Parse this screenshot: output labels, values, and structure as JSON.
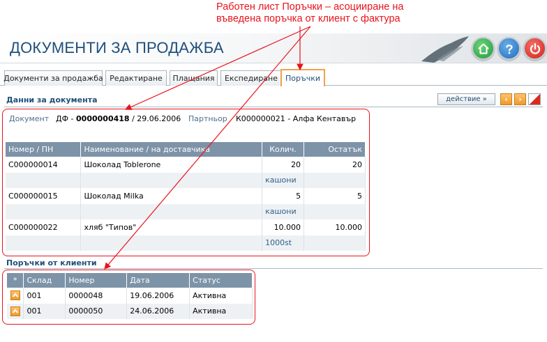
{
  "annotation": {
    "line1": "Работен лист Поръчки – асоцииране на",
    "line2": "въведена поръчка от клиент с фактура",
    "color": "#e8131b"
  },
  "header": {
    "title": "ДОКУМЕНТИ ЗА ПРОДАЖБА",
    "buttons": [
      "home-icon",
      "help-icon",
      "power-icon"
    ]
  },
  "tabs": [
    {
      "label": "Документи за продажба"
    },
    {
      "label": "Редактиране"
    },
    {
      "label": "Плащания"
    },
    {
      "label": "Експедиране"
    },
    {
      "label": "Поръчки",
      "active": true
    }
  ],
  "document_section": {
    "title": "Данни за документа",
    "action_label": "действие »",
    "prev_icon": "chevron-left-icon",
    "next_icon": "chevron-right-icon",
    "document_label": "Документ",
    "document_prefix": "ДФ - ",
    "document_number": "0000000418",
    "document_date": " / 29.06.2006",
    "partner_label": "Партньор",
    "partner_value": "К000000021 - Алфа Кентавър"
  },
  "items_table": {
    "headers": [
      "Номер / ПН",
      "Наименование / на доставчика",
      "Колич.",
      "Остатък"
    ],
    "rows": [
      {
        "code": "C000000014",
        "name": "Шоколад Toblerone",
        "qty": "20",
        "rest": "20",
        "unit": "кашони"
      },
      {
        "code": "C000000015",
        "name": "Шоколад Milka",
        "qty": "5",
        "rest": "5",
        "unit": "кашони"
      },
      {
        "code": "C000000022",
        "name": "хляб \"Типов\"",
        "qty": "10.000",
        "rest": "10.000",
        "unit": "1000st"
      }
    ]
  },
  "orders_section": {
    "title": "Поръчки от клиенти",
    "headers": [
      "*",
      "Склад",
      "Номер",
      "Дата",
      "Статус"
    ],
    "rows": [
      {
        "warehouse": "001",
        "number": "0000048",
        "date": "19.06.2006",
        "status": "Активна"
      },
      {
        "warehouse": "001",
        "number": "0000050",
        "date": "24.06.2006",
        "status": "Активна"
      }
    ]
  },
  "colors": {
    "accent": "#1f4f7a",
    "table_header": "#7d93a7",
    "highlight": "#e8131b",
    "tab_active_border": "#f0a24a"
  }
}
